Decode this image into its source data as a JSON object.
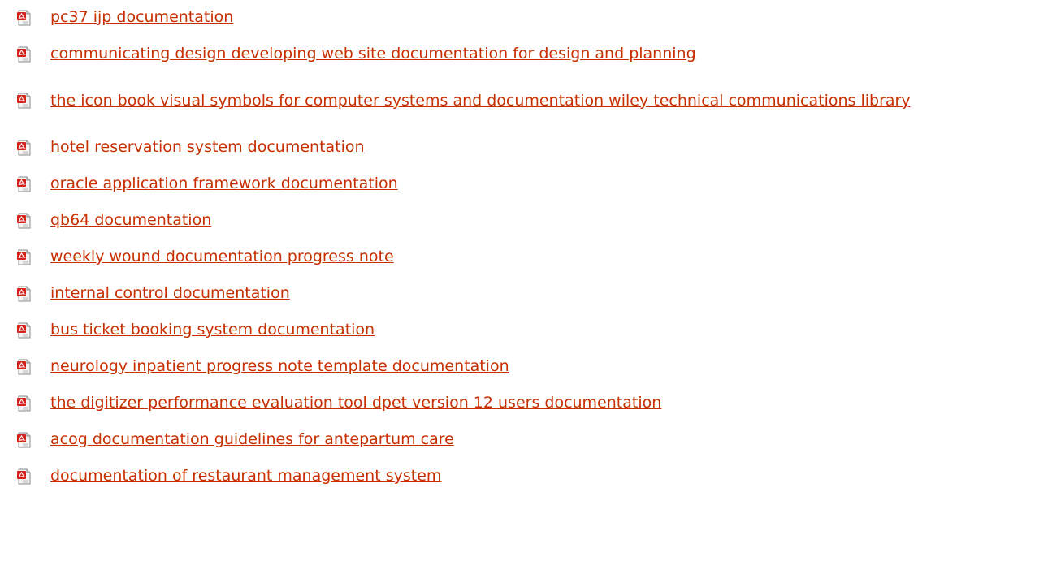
{
  "icon": "pdf-file-icon",
  "accent_color": "#c72f00",
  "items": [
    {
      "label": "pc37 ijp documentation"
    },
    {
      "label": "communicating design developing web site documentation for design and planning"
    },
    {
      "label": "the icon book visual symbols for computer systems and documentation wiley technical communications library"
    },
    {
      "label": "hotel reservation system documentation"
    },
    {
      "label": "oracle application framework documentation"
    },
    {
      "label": "qb64 documentation"
    },
    {
      "label": "weekly wound documentation progress note"
    },
    {
      "label": "internal control documentation"
    },
    {
      "label": "bus ticket booking system documentation"
    },
    {
      "label": "neurology inpatient progress note template documentation"
    },
    {
      "label": "the digitizer performance evaluation tool dpet version 12 users documentation"
    },
    {
      "label": "acog documentation guidelines for antepartum care"
    },
    {
      "label": "documentation of restaurant management system"
    }
  ]
}
